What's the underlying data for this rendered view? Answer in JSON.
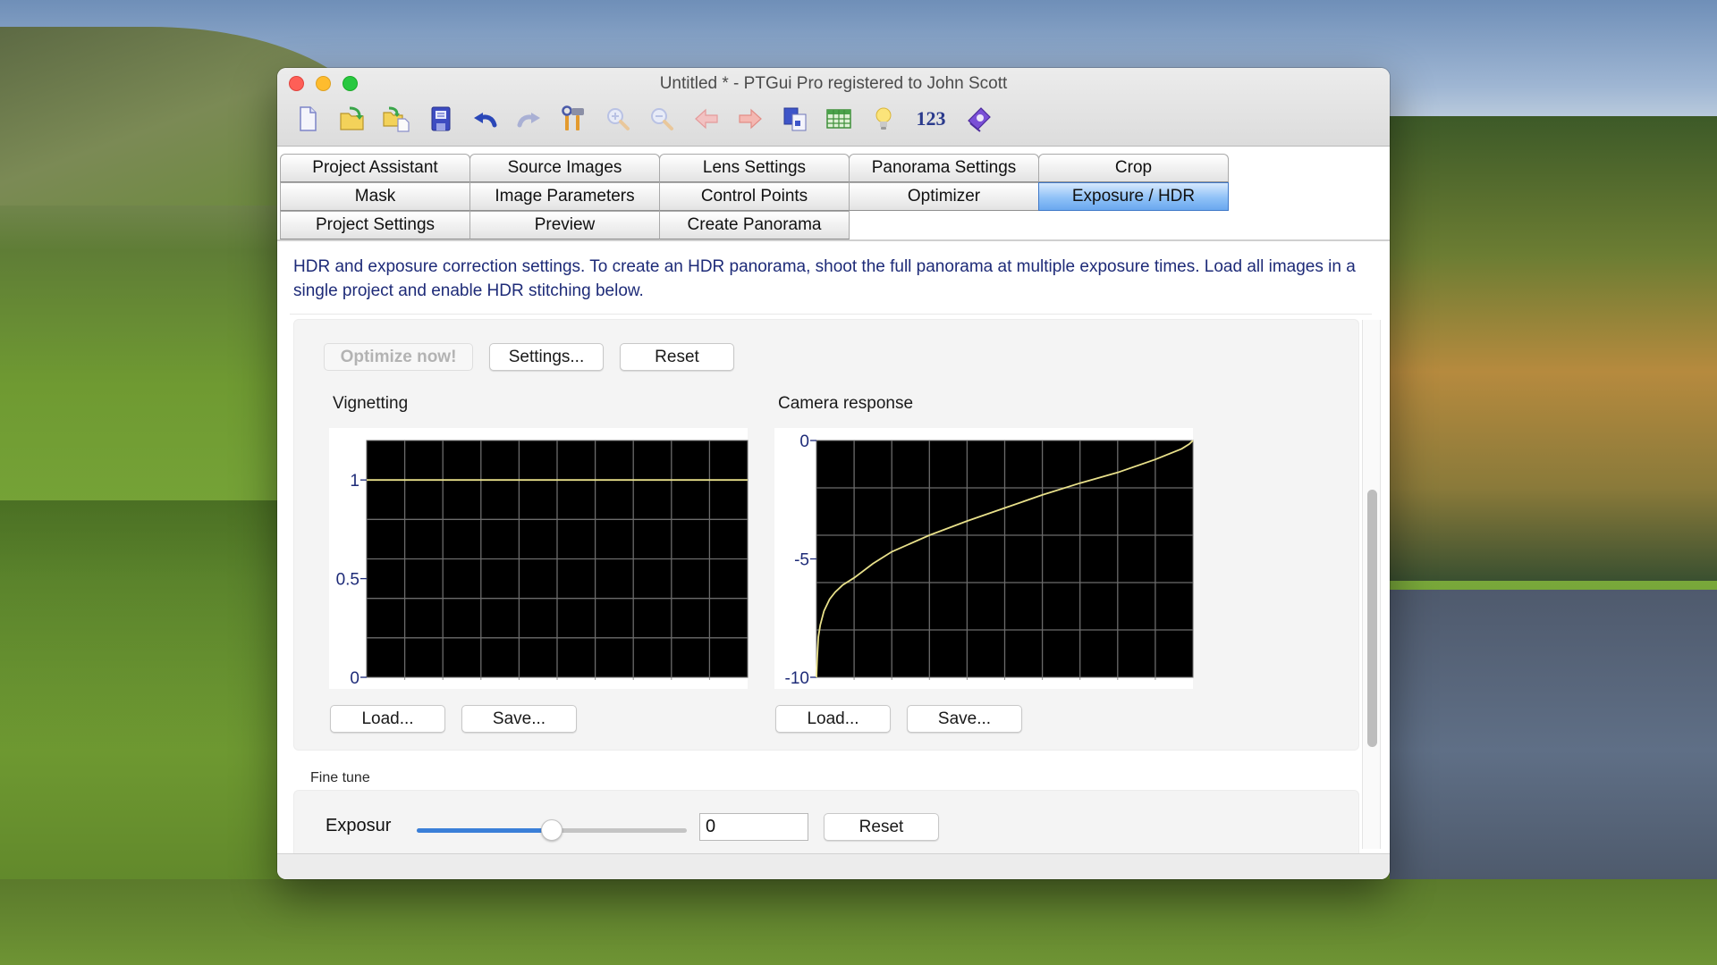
{
  "window": {
    "title": "Untitled * - PTGui Pro registered to John Scott"
  },
  "toolbar": [
    {
      "name": "new-project-icon",
      "label": "New project"
    },
    {
      "name": "open-project-icon",
      "label": "Open project"
    },
    {
      "name": "load-images-icon",
      "label": "Load images"
    },
    {
      "name": "save-icon",
      "label": "Save"
    },
    {
      "name": "undo-icon",
      "label": "Undo"
    },
    {
      "name": "redo-icon",
      "label": "Redo",
      "disabled": true
    },
    {
      "name": "tools-icon",
      "label": "Tools"
    },
    {
      "name": "zoom-in-icon",
      "label": "Zoom in",
      "disabled": true
    },
    {
      "name": "zoom-out-icon",
      "label": "Zoom out",
      "disabled": true
    },
    {
      "name": "back-arrow-icon",
      "label": "Back",
      "disabled": true
    },
    {
      "name": "forward-arrow-icon",
      "label": "Forward"
    },
    {
      "name": "panorama-editor-icon",
      "label": "Panorama editor"
    },
    {
      "name": "table-icon",
      "label": "Table"
    },
    {
      "name": "lightbulb-icon",
      "label": "Tips"
    },
    {
      "name": "numbers-icon",
      "label": "123"
    },
    {
      "name": "help-book-icon",
      "label": "Help"
    }
  ],
  "tabs": {
    "rows": [
      [
        "Project Assistant",
        "Source Images",
        "Lens Settings",
        "Panorama Settings",
        "Crop"
      ],
      [
        "Mask",
        "Image Parameters",
        "Control Points",
        "Optimizer",
        "Exposure / HDR"
      ],
      [
        "Project Settings",
        "Preview",
        "Create Panorama"
      ]
    ],
    "active": "Exposure / HDR"
  },
  "description": "HDR and exposure correction settings. To create an HDR panorama, shoot the full panorama at multiple exposure times. Load all images in a single project and enable HDR stitching below.",
  "actions": {
    "optimize_now": "Optimize now!",
    "settings": "Settings...",
    "reset": "Reset"
  },
  "vignetting": {
    "label": "Vignetting",
    "load": "Load...",
    "save": "Save..."
  },
  "camera_response": {
    "label": "Camera response",
    "load": "Load...",
    "save": "Save..."
  },
  "fine_tune": {
    "label": "Fine tune",
    "exposure_label": "Exposur",
    "exposure_value": "0",
    "slider_fraction": 0.5,
    "reset": "Reset"
  },
  "colors": {
    "active_tab": "#8fc1f7",
    "description_text": "#1e2b78",
    "curve": "#e8e08a",
    "slider_fill": "#3a7fd8"
  },
  "chart_data": [
    {
      "type": "line",
      "title": "Vignetting",
      "xlabel": "",
      "ylabel": "",
      "xlim": [
        0,
        1
      ],
      "ylim": [
        0,
        1.2
      ],
      "yticks": [
        0,
        0.5,
        1
      ],
      "ytick_labels": [
        "0",
        "0.5",
        "1"
      ],
      "grid": true,
      "grid_x_divisions": 10,
      "grid_y_step": 0.2,
      "series": [
        {
          "name": "vignetting",
          "x": [
            0,
            1
          ],
          "y": [
            1,
            1
          ]
        }
      ]
    },
    {
      "type": "line",
      "title": "Camera response",
      "xlabel": "",
      "ylabel": "",
      "xlim": [
        0,
        1
      ],
      "ylim": [
        -10,
        0
      ],
      "yticks": [
        -10,
        -5,
        0
      ],
      "ytick_labels": [
        "-10",
        "-5",
        "0"
      ],
      "grid": true,
      "grid_x_divisions": 10,
      "grid_y_step": 2,
      "series": [
        {
          "name": "response",
          "x": [
            0,
            0.002,
            0.005,
            0.01,
            0.02,
            0.035,
            0.05,
            0.07,
            0.1,
            0.15,
            0.2,
            0.3,
            0.4,
            0.5,
            0.6,
            0.7,
            0.8,
            0.9,
            0.97,
            0.99,
            1.0
          ],
          "y": [
            -10,
            -9.2,
            -8.3,
            -7.8,
            -7.2,
            -6.7,
            -6.4,
            -6.1,
            -5.8,
            -5.2,
            -4.7,
            -4.0,
            -3.4,
            -2.85,
            -2.3,
            -1.8,
            -1.35,
            -0.8,
            -0.35,
            -0.15,
            0
          ]
        }
      ]
    }
  ]
}
